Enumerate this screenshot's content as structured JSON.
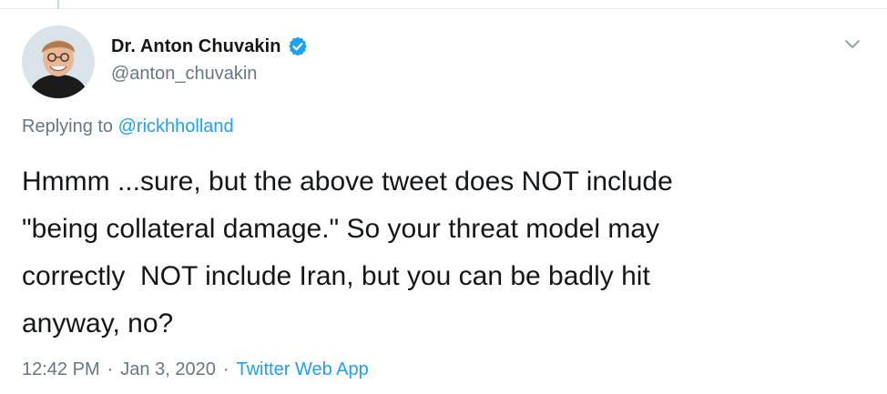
{
  "author": {
    "display_name": "Dr. Anton Chuvakin",
    "handle": "@anton_chuvakin",
    "verified": true,
    "avatar_icon": "user-photo-avatar"
  },
  "reply": {
    "prefix": "Replying to",
    "mention": "@rickhholland"
  },
  "tweet": {
    "text": "Hmmm ...sure, but the above tweet does NOT include\n\"being collateral damage.\" So your threat model may\ncorrectly  NOT include Iran, but you can be badly hit\nanyway, no?"
  },
  "meta": {
    "time": "12:42 PM",
    "separator": "·",
    "date": "Jan 3, 2020",
    "source": "Twitter Web App"
  },
  "colors": {
    "text": "#14171a",
    "secondary": "#657786",
    "link": "#1da1f2",
    "verified_badge": "#1da1f2",
    "divider": "#e6ecf0"
  },
  "icons": {
    "verified": "verified-badge-icon",
    "more": "chevron-down-icon"
  }
}
